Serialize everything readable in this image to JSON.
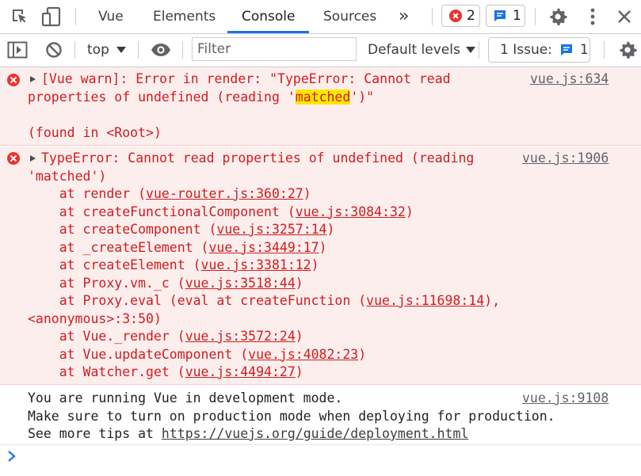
{
  "tabs": [
    "Vue",
    "Elements",
    "Console",
    "Sources"
  ],
  "active_tab": "Console",
  "more_tabs_glyph": "»",
  "errors_count": "2",
  "messages_count": "1",
  "toolbar": {
    "context": "top",
    "filter_placeholder": "Filter",
    "levels": "Default levels",
    "issues_label": "1 Issue:",
    "issues_count": "1"
  },
  "messages": [
    {
      "type": "error",
      "source": "vue.js:634",
      "line1": "[Vue warn]: Error in render: \"TypeError: Cannot read",
      "line2_pre": "properties of undefined (reading '",
      "line2_highlight": "matched",
      "line2_post": "')\"",
      "line3": "(found in <Root>)"
    },
    {
      "type": "error",
      "source": "vue.js:1906",
      "line1": "TypeError: Cannot read properties of undefined (reading",
      "line2": "'matched')",
      "stack": [
        {
          "fn": "    at render (",
          "link": "vue-router.js:360:27",
          "end": ")"
        },
        {
          "fn": "    at createFunctionalComponent (",
          "link": "vue.js:3084:32",
          "end": ")"
        },
        {
          "fn": "    at createComponent (",
          "link": "vue.js:3257:14",
          "end": ")"
        },
        {
          "fn": "    at _createElement (",
          "link": "vue.js:3449:17",
          "end": ")"
        },
        {
          "fn": "    at createElement (",
          "link": "vue.js:3381:12",
          "end": ")"
        },
        {
          "fn": "    at Proxy.vm._c (",
          "link": "vue.js:3518:44",
          "end": ")"
        },
        {
          "fn": "    at Proxy.eval (eval at createFunction (",
          "link": "vue.js:11698:14",
          "end": "),"
        },
        {
          "fn": "<anonymous>:3:50)",
          "link": "",
          "end": ""
        },
        {
          "fn": "    at Vue._render (",
          "link": "vue.js:3572:24",
          "end": ")"
        },
        {
          "fn": "    at Vue.updateComponent (",
          "link": "vue.js:4082:23",
          "end": ")"
        },
        {
          "fn": "    at Watcher.get (",
          "link": "vue.js:4494:27",
          "end": ")"
        }
      ]
    },
    {
      "type": "log",
      "source": "vue.js:9108",
      "line1": "You are running Vue in development mode.",
      "line2": "Make sure to turn on production mode when deploying for production.",
      "line3_pre": "See more tips at ",
      "line3_link": "https://vuejs.org/guide/deployment.html"
    }
  ],
  "colors": {
    "error_text": "#d01c1c",
    "error_bg": "#fdeeee",
    "accent": "#1a73e8",
    "highlight": "#ffe600"
  }
}
